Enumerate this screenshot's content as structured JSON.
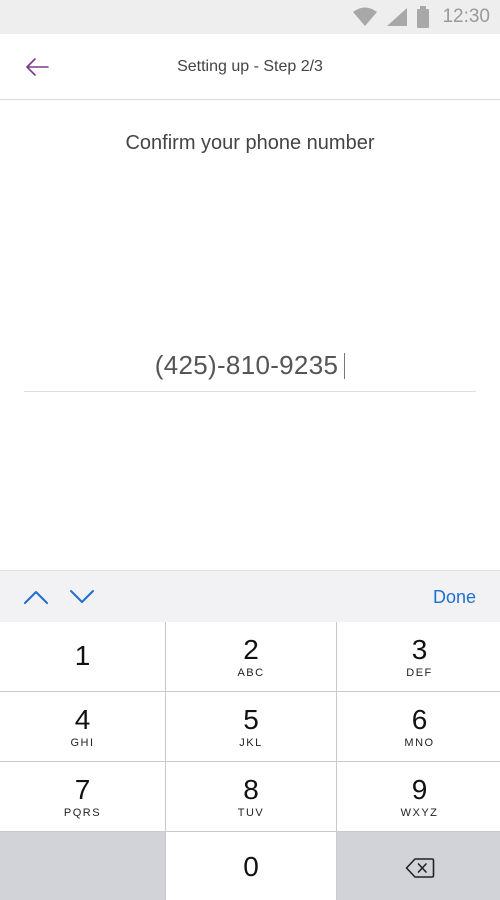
{
  "status_bar": {
    "time": "12:30",
    "icons": [
      "wifi-icon",
      "signal-icon",
      "battery-icon"
    ]
  },
  "header": {
    "title": "Setting up - Step 2/3",
    "back_icon": "arrow-left-icon",
    "accent_color": "#7a3a8c"
  },
  "content": {
    "prompt": "Confirm your phone number",
    "phone_value": "(425)-810-9235"
  },
  "accessory": {
    "up_icon": "chevron-up-icon",
    "down_icon": "chevron-down-icon",
    "done_label": "Done",
    "accent_color": "#1f6fd1"
  },
  "keypad": {
    "keys": [
      {
        "digit": "1",
        "letters": ""
      },
      {
        "digit": "2",
        "letters": "ABC"
      },
      {
        "digit": "3",
        "letters": "DEF"
      },
      {
        "digit": "4",
        "letters": "GHI"
      },
      {
        "digit": "5",
        "letters": "JKL"
      },
      {
        "digit": "6",
        "letters": "MNO"
      },
      {
        "digit": "7",
        "letters": "PQRS"
      },
      {
        "digit": "8",
        "letters": "TUV"
      },
      {
        "digit": "9",
        "letters": "WXYZ"
      },
      {
        "digit": "",
        "letters": ""
      },
      {
        "digit": "0",
        "letters": ""
      }
    ],
    "backspace_icon": "backspace-icon"
  }
}
